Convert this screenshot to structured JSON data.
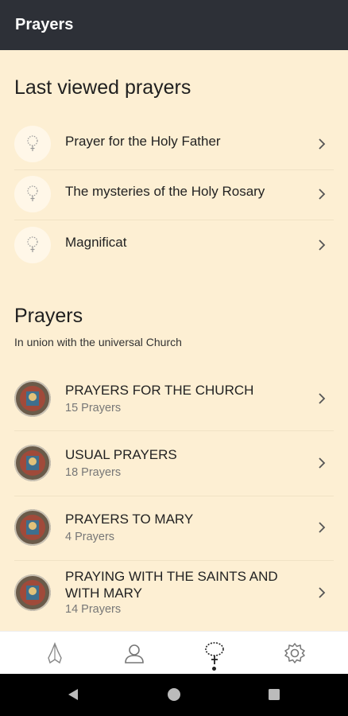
{
  "appbar": {
    "title": "Prayers"
  },
  "last_viewed": {
    "title": "Last viewed prayers",
    "items": [
      {
        "label": "Prayer for the Holy Father"
      },
      {
        "label": "The mysteries of the Holy Rosary"
      },
      {
        "label": "Magnificat"
      }
    ]
  },
  "prayers": {
    "title": "Prayers",
    "subtitle": "In union with the universal Church",
    "items": [
      {
        "label": "PRAYERS FOR THE CHURCH",
        "count": "15 Prayers"
      },
      {
        "label": "USUAL PRAYERS",
        "count": "18 Prayers"
      },
      {
        "label": "PRAYERS TO MARY",
        "count": "4 Prayers"
      },
      {
        "label": "PRAYING WITH THE SAINTS AND",
        "label2": "WITH MARY",
        "count": "14 Prayers"
      }
    ]
  },
  "bottom_nav": {
    "items": [
      {
        "icon": "praying-hands-icon"
      },
      {
        "icon": "person-icon"
      },
      {
        "icon": "rosary-icon",
        "selected": true
      },
      {
        "icon": "settings-icon"
      }
    ]
  },
  "colors": {
    "background": "#fdefd3",
    "appbar": "#2d3037",
    "text": "#222222"
  }
}
